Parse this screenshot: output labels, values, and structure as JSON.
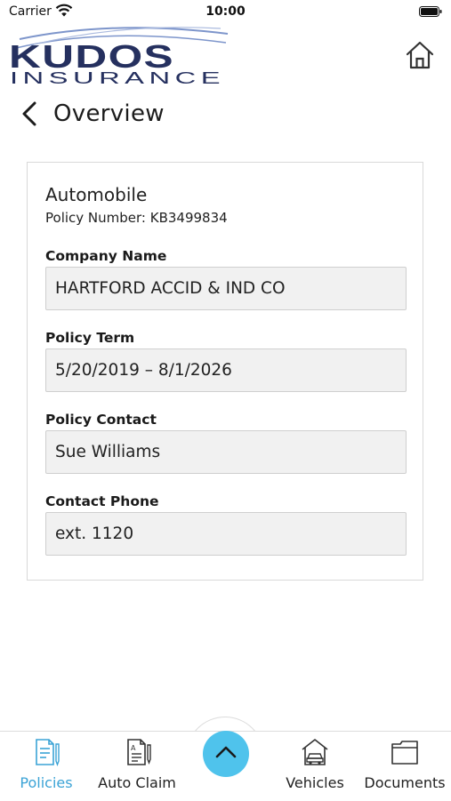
{
  "status_bar": {
    "carrier": "Carrier",
    "time": "10:00"
  },
  "header": {
    "logo_top": "KUDOS",
    "logo_bottom": "INSURANCE"
  },
  "nav": {
    "title": "Overview"
  },
  "policy": {
    "type": "Automobile",
    "number_label": "Policy Number:",
    "number": "KB3499834",
    "fields": [
      {
        "label": "Company Name",
        "value": "HARTFORD ACCID & IND CO"
      },
      {
        "label": "Policy Term",
        "value": "5/20/2019 – 8/1/2026"
      },
      {
        "label": "Policy Contact",
        "value": "Sue Williams"
      },
      {
        "label": "Contact Phone",
        "value": "ext. 1120"
      }
    ]
  },
  "tabbar": {
    "active": "Policies",
    "tabs": [
      {
        "label": "Policies",
        "icon": "policies-icon"
      },
      {
        "label": "Auto Claim",
        "icon": "auto-claim-icon"
      },
      {
        "label": "Vehicles",
        "icon": "vehicles-icon"
      },
      {
        "label": "Documents",
        "icon": "documents-icon"
      }
    ],
    "fab_icon": "chevron-up-icon"
  },
  "colors": {
    "accent": "#3ba3d6",
    "fab": "#4fc3ec",
    "logo_dark": "#25305f",
    "logo_light": "#6d86c1"
  }
}
